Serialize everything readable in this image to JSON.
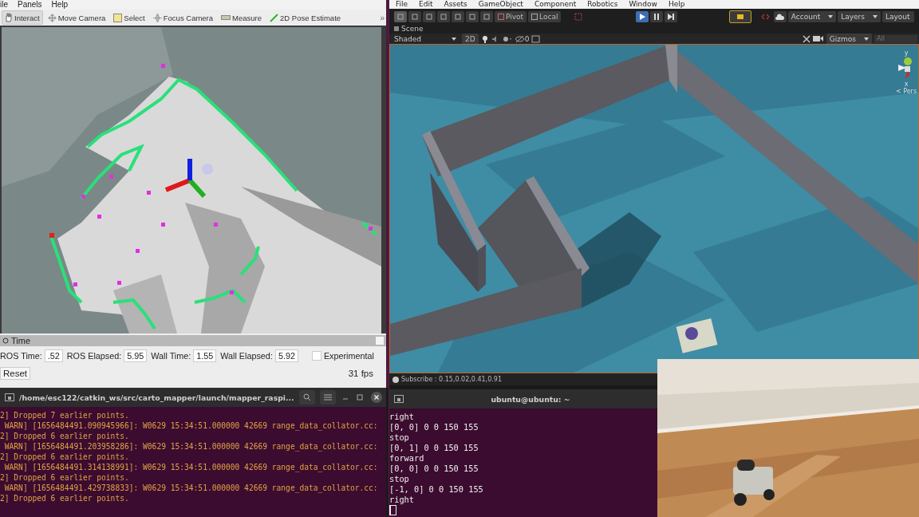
{
  "rviz": {
    "menu": [
      "ile",
      "Panels",
      "Help"
    ],
    "tools": [
      {
        "label": "Interact",
        "selected": true
      },
      {
        "label": "Move Camera",
        "selected": false
      },
      {
        "label": "Select",
        "selected": false
      },
      {
        "label": "Focus Camera",
        "selected": false
      },
      {
        "label": "Measure",
        "selected": false
      },
      {
        "label": "2D Pose Estimate",
        "selected": false
      }
    ],
    "more": "»",
    "time_panel": {
      "title": "Time",
      "fields": [
        {
          "label": "ROS Time:",
          "value": ".52"
        },
        {
          "label": "ROS Elapsed:",
          "value": "5.95"
        },
        {
          "label": "Wall Time:",
          "value": "1.55"
        },
        {
          "label": "Wall Elapsed:",
          "value": "5.92"
        }
      ],
      "experimental": {
        "label": "Experimental",
        "checked": false
      },
      "reset": "Reset",
      "fps": "31 fps"
    }
  },
  "unity": {
    "menu": [
      "File",
      "Edit",
      "Assets",
      "GameObject",
      "Component",
      "Robotics",
      "Window",
      "Help"
    ],
    "pivot": "Pivot",
    "local": "Local",
    "playing": true,
    "account": "Account",
    "layers": "Layers",
    "layout": "Layout",
    "scene_tab": "Scene",
    "shading": "Shaded",
    "mode_2d": "2D",
    "hidden_count": "0",
    "gizmos": "Gizmos",
    "search_placeholder": "All",
    "gizmo_labels": [
      "y",
      "x",
      "< Pers"
    ],
    "status": "Subscribe : 0.15,0.02,0.41,0.91"
  },
  "terminal_left": {
    "title": "/home/esc122/catkin_ws/src/carto_mapper/launch/mapper_raspi...",
    "lines": [
      "2] Dropped 7 earlier points.",
      " WARN] [1656484491.090945966]: W0629 15:34:51.000000 42669 range_data_collator.cc:",
      "2] Dropped 6 earlier points.",
      " WARN] [1656484491.203958286]: W0629 15:34:51.000000 42669 range_data_collator.cc:",
      "2] Dropped 6 earlier points.",
      " WARN] [1656484491.314138991]: W0629 15:34:51.000000 42669 range_data_collator.cc:",
      "2] Dropped 6 earlier points.",
      " WARN] [1656484491.429738833]: W0629 15:34:51.000000 42669 range_data_collator.cc:",
      "2] Dropped 6 earlier points."
    ]
  },
  "terminal_right": {
    "title": "ubuntu@ubuntu: ~",
    "lines": [
      "right",
      "[0, 0] 0 0 150 155",
      "stop",
      "[0, 1] 0 0 150 155",
      "forward",
      "[0, 0] 0 0 150 155",
      "stop",
      "[-1, 0] 0 0 150 155",
      "right"
    ]
  }
}
